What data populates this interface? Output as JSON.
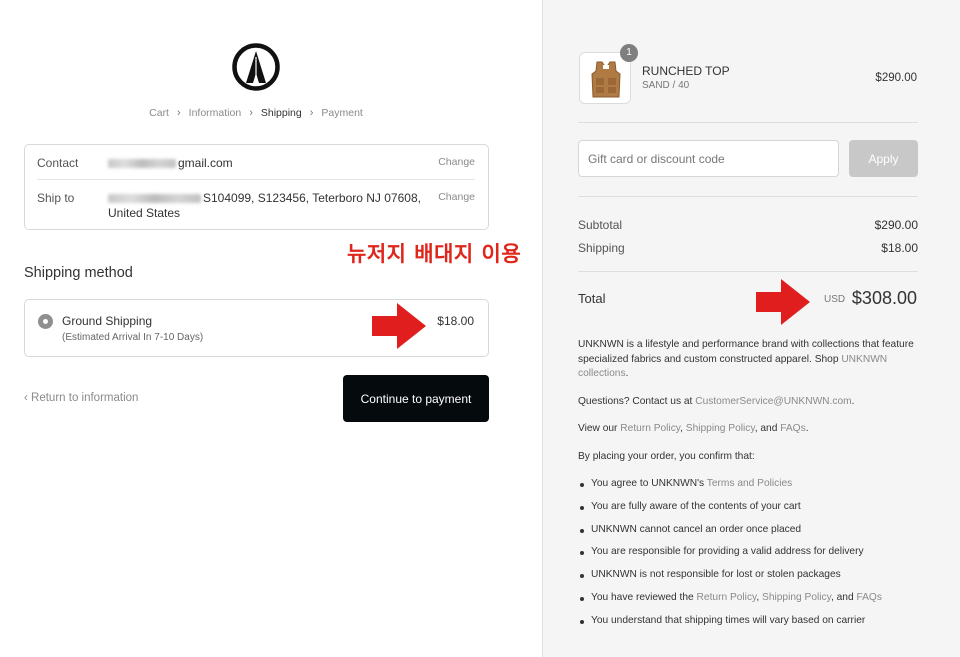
{
  "breadcrumb": {
    "cart": "Cart",
    "information": "Information",
    "shipping": "Shipping",
    "payment": "Payment"
  },
  "info": {
    "contact_label": "Contact",
    "contact_value": "gmail.com",
    "ship_label": "Ship to",
    "ship_value_line1": "S104099, S123456, Teterboro NJ 07608,",
    "ship_value_line2": "United States",
    "change_label": "Change"
  },
  "annotation": "뉴저지 배대지 이용",
  "shipping_method": {
    "title": "Shipping method",
    "name": "Ground Shipping",
    "sub": "(Estimated Arrival In 7-10 Days)",
    "price": "$18.00"
  },
  "actions": {
    "return_label": "Return to information",
    "continue_label": "Continue to payment"
  },
  "product": {
    "quantity": "1",
    "name": "RUNCHED TOP",
    "variant": "SAND / 40",
    "price": "$290.00"
  },
  "discount": {
    "placeholder": "Gift card or discount code",
    "apply_label": "Apply"
  },
  "summary": {
    "subtotal_label": "Subtotal",
    "subtotal_value": "$290.00",
    "shipping_label": "Shipping",
    "shipping_value": "$18.00",
    "total_label": "Total",
    "currency": "USD",
    "total_value": "$308.00"
  },
  "notes": {
    "about_text": "UNKNWN is a lifestyle and performance brand with collections that feature specialized fabrics and custom constructed apparel. Shop ",
    "about_link": "UNKNWN collections",
    "questions_text": "Questions? Contact us at ",
    "questions_email": "CustomerService@UNKNWN.com",
    "view_text": "View our ",
    "return_policy": "Return Policy",
    "shipping_policy": "Shipping Policy",
    "and_text": ", and ",
    "faqs": "FAQs",
    "confirm_text": "By placing your order, you confirm that:",
    "bullet1_text": "You agree to UNKNWN's ",
    "bullet1_link": "Terms and Policies",
    "bullet2": "You are fully aware of the contents of your cart",
    "bullet3": "UNKNWN cannot cancel an order once placed",
    "bullet4": "You are responsible for providing a valid address for delivery",
    "bullet5": "UNKNWN is not responsible for lost or stolen packages",
    "bullet6_text": "You have reviewed the ",
    "bullet7": "You understand that shipping times will vary based on carrier"
  },
  "colors": {
    "button_dark": "#050a0d",
    "annotation_red": "#e0251b",
    "right_panel_bg": "#f5f5f5"
  }
}
